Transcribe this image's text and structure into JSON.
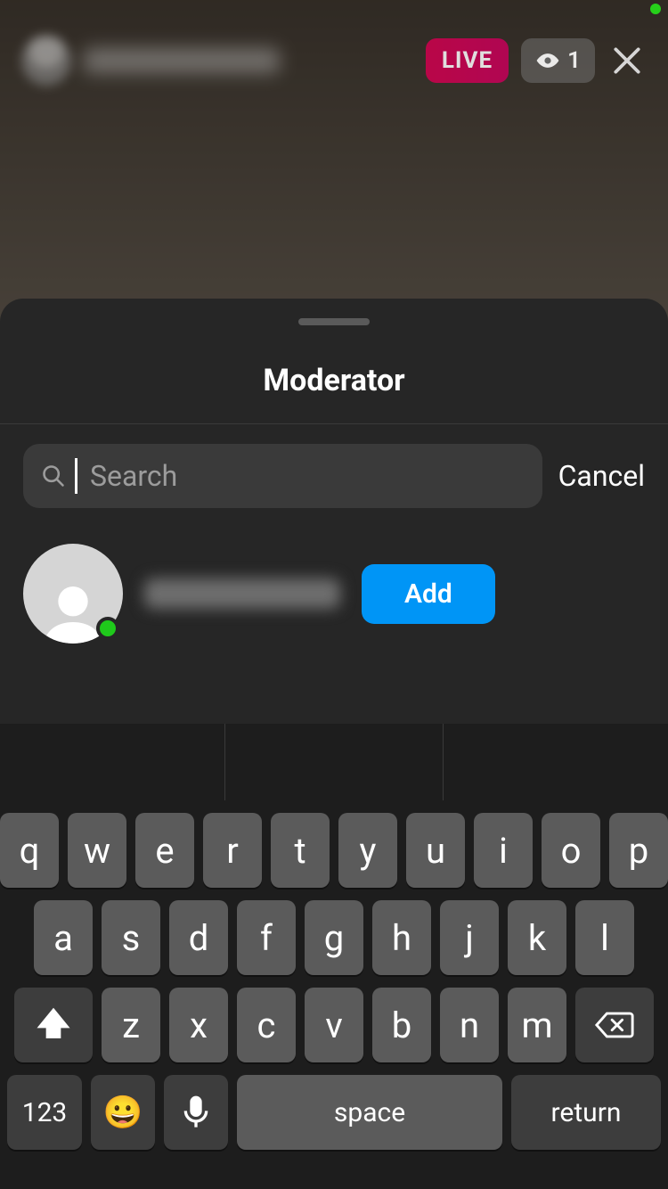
{
  "topbar": {
    "live_label": "LIVE",
    "viewer_count": "1"
  },
  "sheet": {
    "title": "Moderator",
    "search_placeholder": "Search",
    "cancel_label": "Cancel",
    "results": [
      {
        "add_label": "Add",
        "online": true
      }
    ]
  },
  "keyboard": {
    "row1": [
      "q",
      "w",
      "e",
      "r",
      "t",
      "y",
      "u",
      "i",
      "o",
      "p"
    ],
    "row2": [
      "a",
      "s",
      "d",
      "f",
      "g",
      "h",
      "j",
      "k",
      "l"
    ],
    "row3": [
      "z",
      "x",
      "c",
      "v",
      "b",
      "n",
      "m"
    ],
    "key_123": "123",
    "key_space": "space",
    "key_return": "return"
  }
}
